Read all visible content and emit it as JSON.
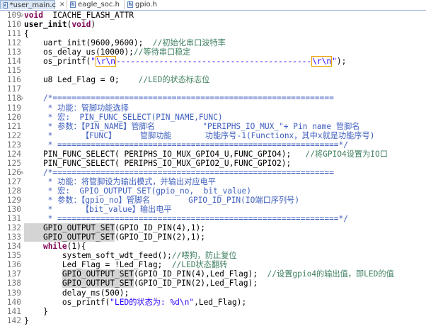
{
  "tabs": [
    {
      "label": "*user_main.c",
      "active": true
    },
    {
      "label": "eagle_soc.h",
      "active": false
    },
    {
      "label": "gpio.h",
      "active": false
    }
  ],
  "colors": {
    "keyword": "#7f0055",
    "comment": "#3f7f5f",
    "doc_comment": "#3f5fbf",
    "string": "#2a00ff",
    "line_number": "#787878"
  },
  "lines": [
    {
      "n": "109",
      "fold": "⊖",
      "segs": [
        [
          "kw",
          "void"
        ],
        [
          "",
          "  ICACHE_FLASH_ATTR"
        ]
      ]
    },
    {
      "n": "110",
      "segs": [
        [
          "fn",
          "user_init"
        ],
        [
          "",
          "("
        ],
        [
          "kw",
          "void"
        ],
        [
          "",
          ")"
        ]
      ]
    },
    {
      "n": "111",
      "segs": [
        [
          "",
          "{"
        ]
      ]
    },
    {
      "n": "112",
      "segs": [
        [
          "",
          "    uart_init(9600,9600);  "
        ],
        [
          "cm",
          "//初始化串口波特率"
        ]
      ]
    },
    {
      "n": "113",
      "segs": [
        [
          "",
          "    os_delay_us(10000);"
        ],
        [
          "cm",
          "//等待串口稳定"
        ]
      ]
    },
    {
      "n": "114",
      "segs": [
        [
          "",
          "    os_printf("
        ],
        [
          "str",
          "\""
        ],
        [
          "esc",
          "\\r\\n"
        ],
        [
          "str",
          "-----------------------------------------"
        ],
        [
          "esc",
          "\\r\\n"
        ],
        [
          "str",
          "\""
        ],
        [
          "",
          ");"
        ]
      ]
    },
    {
      "n": "115",
      "segs": [
        [
          "",
          ""
        ]
      ]
    },
    {
      "n": "116",
      "segs": [
        [
          "",
          "    u8 Led_Flag = 0;    "
        ],
        [
          "cm",
          "//LED的状态标志位"
        ]
      ]
    },
    {
      "n": "117",
      "segs": [
        [
          "",
          ""
        ]
      ]
    },
    {
      "n": "118",
      "fold": "⊖",
      "segs": [
        [
          "cmr",
          "    /*==========================================================="
        ]
      ]
    },
    {
      "n": "119",
      "segs": [
        [
          "cmr",
          "     * 功能：管脚功能选择"
        ]
      ]
    },
    {
      "n": "120",
      "segs": [
        [
          "cmr",
          "     * 宏:  PIN_FUNC_SELECT(PIN_NAME,FUNC)"
        ]
      ]
    },
    {
      "n": "121",
      "segs": [
        [
          "cmr",
          "     * 参数：【PIN_NAME】管脚名          \"PERIPHS_IO_MUX_\"+ Pin name 管脚名"
        ]
      ]
    },
    {
      "n": "122",
      "segs": [
        [
          "cmr",
          "     *      【FUNC】     管脚功能       功能序号-1(Functionx，其中x就是功能序号)"
        ]
      ]
    },
    {
      "n": "123",
      "segs": [
        [
          "cmr",
          "     * ===========================================================*/"
        ]
      ]
    },
    {
      "n": "124",
      "segs": [
        [
          "",
          "    PIN_FUNC_SELECT( PERIPHS_IO_MUX_GPIO4_U,FUNC_GPIO4);   "
        ],
        [
          "cm",
          "//将GPIO4设置为IO口"
        ]
      ]
    },
    {
      "n": "125",
      "segs": [
        [
          "",
          "    PIN_FUNC_SELECT( PERIPHS_IO_MUX_GPIO2_U,FUNC_GPIO2);"
        ]
      ]
    },
    {
      "n": "126",
      "fold": "⊖",
      "segs": [
        [
          "cmr",
          "    /*==========================================================="
        ]
      ]
    },
    {
      "n": "127",
      "segs": [
        [
          "cmr",
          "     * 功能：将管脚设为输出模式，并输出对应电平"
        ]
      ]
    },
    {
      "n": "128",
      "segs": [
        [
          "cmr",
          "     * 宏:  GPIO_OUTPUT_SET(gpio_no,  bit_value)"
        ]
      ]
    },
    {
      "n": "129",
      "segs": [
        [
          "cmr",
          "     * 参数：【gpio_no】管脚名        GPIO_ID_PIN(IO端口序列号)"
        ]
      ]
    },
    {
      "n": "130",
      "segs": [
        [
          "cmr",
          "     *      【bit_value】输出电平"
        ]
      ]
    },
    {
      "n": "131",
      "segs": [
        [
          "cmr",
          "     * ===========================================================*/"
        ]
      ]
    },
    {
      "n": "132",
      "segs": [
        [
          "hl",
          "    GPIO_OUTPUT_SET"
        ],
        [
          "",
          "(GPIO_ID_PIN(4),1);"
        ]
      ]
    },
    {
      "n": "133",
      "segs": [
        [
          "hl",
          "    GPIO_OUTPUT_SET"
        ],
        [
          "",
          "(GPIO_ID_PIN(2),1);"
        ]
      ]
    },
    {
      "n": "134",
      "segs": [
        [
          "",
          "    "
        ],
        [
          "kw",
          "while"
        ],
        [
          "",
          "(1){"
        ]
      ]
    },
    {
      "n": "135",
      "segs": [
        [
          "",
          "        system_soft_wdt_feed();"
        ],
        [
          "cm",
          "//喂狗，防止复位"
        ]
      ]
    },
    {
      "n": "136",
      "segs": [
        [
          "",
          "        Led_Flag = !Led_Flag;  "
        ],
        [
          "cm",
          "//LED状态翻转"
        ]
      ]
    },
    {
      "n": "137",
      "segs": [
        [
          "",
          "        "
        ],
        [
          "hl",
          "GPIO_OUTPUT_SET"
        ],
        [
          "",
          "(GPIO_ID_PIN(4),Led_Flag);  "
        ],
        [
          "cm",
          "//设置gpio4的输出值，即LED的值"
        ]
      ]
    },
    {
      "n": "138",
      "segs": [
        [
          "",
          "        "
        ],
        [
          "hl",
          "GPIO_OUTPUT_SET"
        ],
        [
          "",
          "(GPIO_ID_PIN(2),Led_Flag);"
        ]
      ]
    },
    {
      "n": "139",
      "segs": [
        [
          "",
          "        delay_ms(500);"
        ]
      ]
    },
    {
      "n": "140",
      "segs": [
        [
          "",
          "        os_printf("
        ],
        [
          "str",
          "\"LED的状态为: %d\\n\""
        ],
        [
          "",
          ",Led_Flag);"
        ]
      ]
    },
    {
      "n": "141",
      "segs": [
        [
          "",
          "    }"
        ]
      ]
    },
    {
      "n": "142",
      "segs": [
        [
          "",
          "}"
        ]
      ]
    }
  ]
}
